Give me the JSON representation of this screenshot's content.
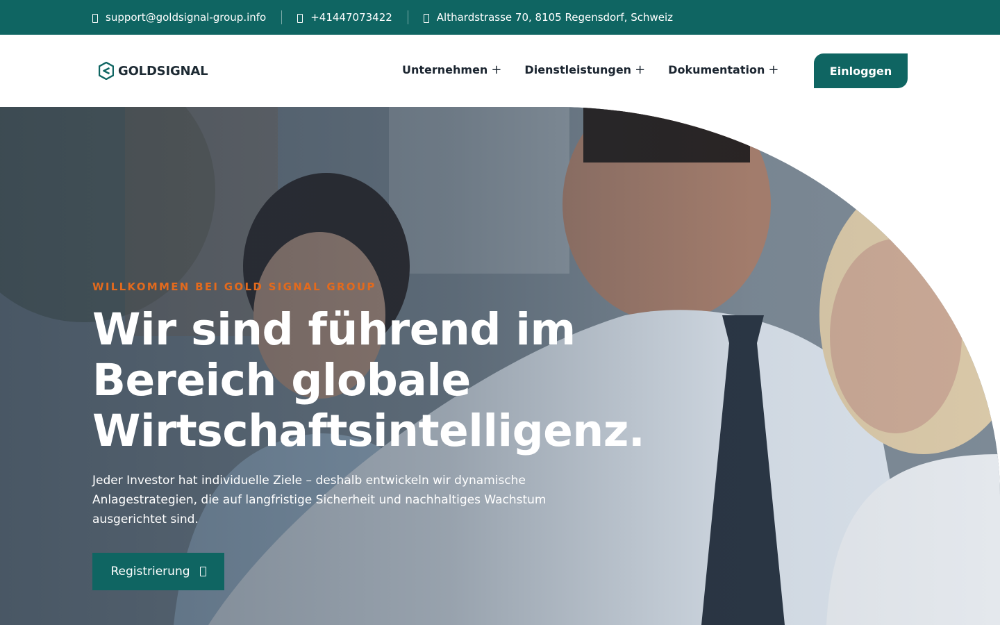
{
  "topbar": {
    "email": "support@goldsignal-group.info",
    "phone": "+41447073422",
    "address": "Althardstrasse 70, 8105 Regensdorf, Schweiz",
    "email_icon": "envelope-icon",
    "phone_icon": "phone-icon",
    "address_icon": "map-pin-icon"
  },
  "header": {
    "logo_text": "GOLDSIGNAL",
    "nav": [
      {
        "label": "Unternehmen",
        "suffix": "+"
      },
      {
        "label": "Dienstleistungen",
        "suffix": "+"
      },
      {
        "label": "Dokumentation",
        "suffix": "+"
      }
    ],
    "login_label": "Einloggen"
  },
  "hero": {
    "eyebrow": "WILLKOMMEN BEI GOLD SIGNAL GROUP",
    "headline_line1": "Wir sind führend im",
    "headline_line2": "Bereich globale",
    "headline_line3": "Wirtschaftsintelligenz.",
    "lead_line1": "Jeder Investor hat individuelle Ziele – deshalb entwickeln wir dynamische",
    "lead_line2": "Anlagestrategien, die auf langfristige Sicherheit und nachhaltiges Wachstum",
    "lead_line3": "ausgerichtet sind.",
    "register_label": "Registrierung",
    "register_icon": "arrow-right-icon"
  },
  "colors": {
    "brand": "#0f6562",
    "accent": "#e36a1d",
    "text_dark": "#1b2530"
  }
}
